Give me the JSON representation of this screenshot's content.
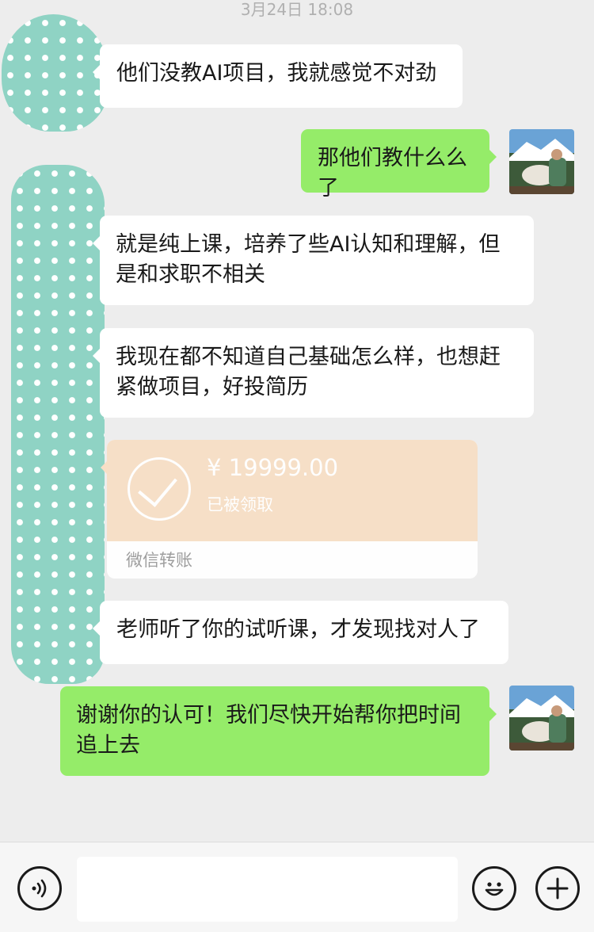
{
  "chat": {
    "timestamp": "3月24日 18:08",
    "messages": [
      {
        "side": "in",
        "type": "text",
        "text": "他们没教AI项目，我就感觉不对劲"
      },
      {
        "side": "out",
        "type": "text",
        "text": "那他们教什么么了"
      },
      {
        "side": "in",
        "type": "text",
        "text": "就是纯上课，培养了些AI认知和理解，但是和求职不相关"
      },
      {
        "side": "in",
        "type": "text",
        "text": "我现在都不知道自己基础怎么样，也想赶紧做项目，好投简历"
      },
      {
        "side": "in",
        "type": "transfer",
        "amount": "¥ 19999.00",
        "status": "已被领取",
        "label": "微信转账"
      },
      {
        "side": "in",
        "type": "text",
        "text": "老师听了你的试听课，才发现找对人了"
      },
      {
        "side": "out",
        "type": "text",
        "text": "谢谢你的认可！我们尽快开始帮你把时间追上去"
      }
    ]
  },
  "input_bar": {
    "voice_icon": "voice-icon",
    "emoji_icon": "emoji-icon",
    "more_icon": "plus-icon",
    "text_value": ""
  },
  "colors": {
    "background": "#ededed",
    "incoming_bubble": "#ffffff",
    "outgoing_bubble": "#95ec69",
    "transfer_received": "#f7dfc6",
    "avatar_mask": "#8fd3c4"
  }
}
